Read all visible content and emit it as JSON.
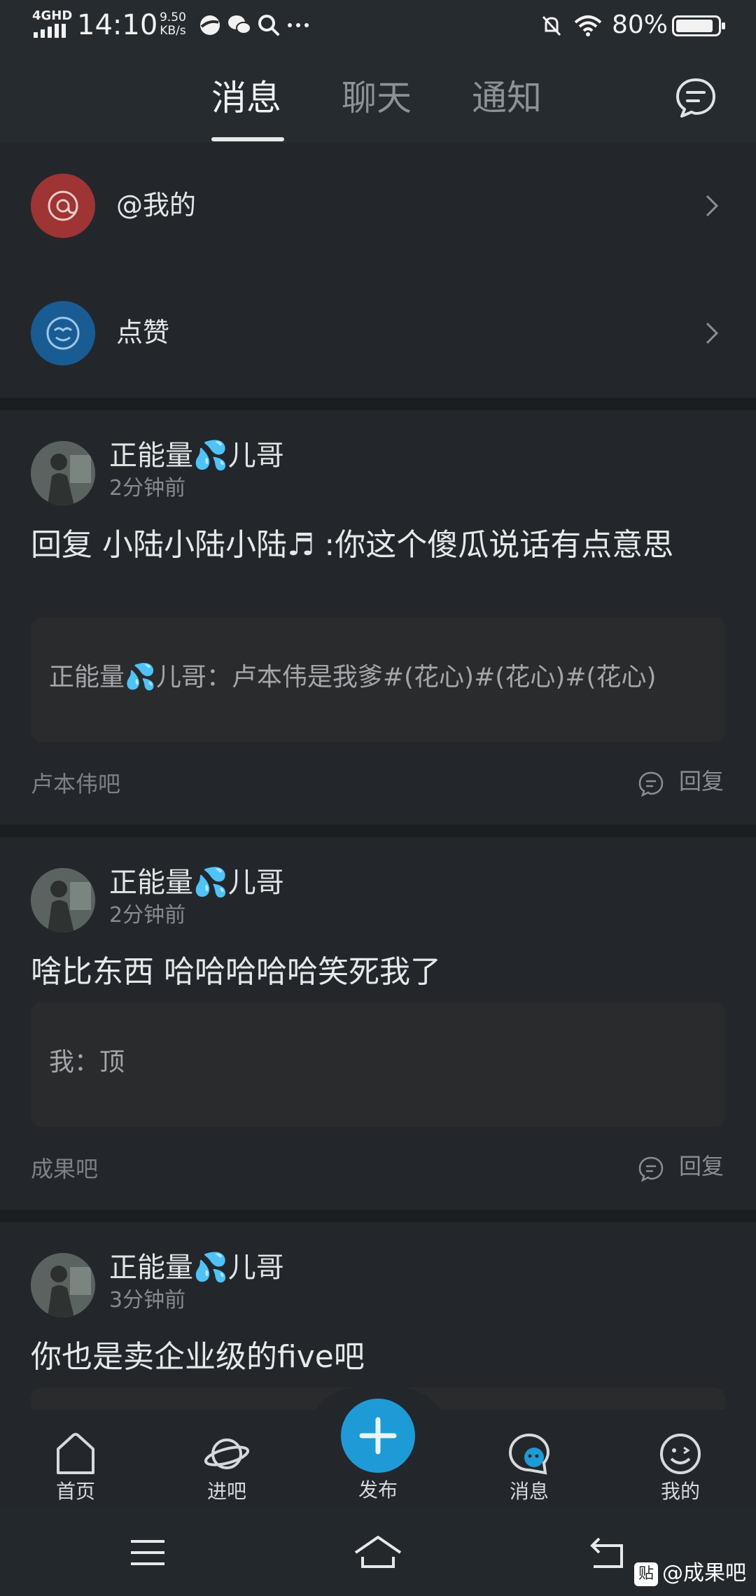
{
  "status": {
    "network": "4GHD",
    "time": "14:10",
    "speed": "9.50",
    "speed_unit": "KB/s",
    "battery": "80%",
    "icons": [
      "signal-icon",
      "browser-icon",
      "wechat-icon",
      "search-icon",
      "more-icon",
      "mute-icon",
      "wifi-icon",
      "battery-icon"
    ]
  },
  "header": {
    "tabs": [
      {
        "label": "消息",
        "active": true
      },
      {
        "label": "聊天",
        "active": false
      },
      {
        "label": "通知",
        "active": false
      }
    ],
    "action_icon": "chat-bubble-icon"
  },
  "rows": [
    {
      "label": "@我的",
      "icon": "at-icon",
      "color": "#b43a3a"
    },
    {
      "label": "点赞",
      "icon": "like-icon",
      "color": "#1f6aa8"
    }
  ],
  "cards": [
    {
      "user": "正能量💦儿哥",
      "time": "2分钟前",
      "content": "回复 小陆小陆小陆♬ :你这个傻瓜说话有点意思",
      "quote": "正能量💦儿哥：卢本伟是我爹#(花心)#(花心)#(花心)",
      "forum": "卢本伟吧",
      "reply": "回复"
    },
    {
      "user": "正能量💦儿哥",
      "time": "2分钟前",
      "content": "啥比东西 哈哈哈哈哈笑死我了",
      "quote": "我：顶",
      "forum": "成果吧",
      "reply": "回复"
    },
    {
      "user": "正能量💦儿哥",
      "time": "3分钟前",
      "content": "你也是卖企业级的five吧"
    }
  ],
  "bottom_nav": [
    {
      "label": "首页",
      "icon": "home-icon"
    },
    {
      "label": "进吧",
      "icon": "planet-icon"
    },
    {
      "label": "发布",
      "icon": "plus-icon"
    },
    {
      "label": "消息",
      "icon": "message-icon"
    },
    {
      "label": "我的",
      "icon": "profile-icon"
    }
  ],
  "watermark": {
    "badge": "贴",
    "text": "@成果吧"
  },
  "colors": {
    "accent": "#1e9bd6",
    "background": "#1f2327"
  }
}
